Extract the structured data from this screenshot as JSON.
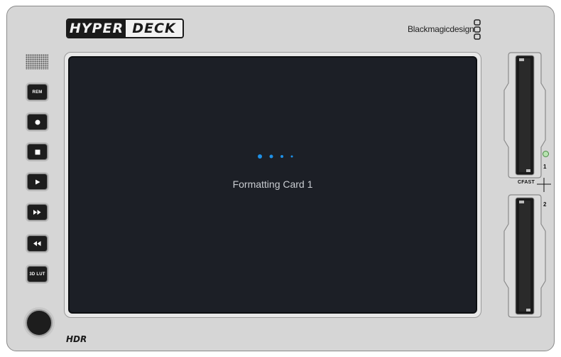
{
  "device": {
    "logo_left": "HYPER",
    "logo_right": "DECK",
    "brand": "Blackmagicdesign",
    "hdr_label": "HDR"
  },
  "buttons": [
    {
      "name": "rem-button",
      "label": "REM",
      "icon": "text"
    },
    {
      "name": "record-button",
      "label": "",
      "icon": "record-dot-icon"
    },
    {
      "name": "stop-button",
      "label": "",
      "icon": "stop-square-icon"
    },
    {
      "name": "play-button",
      "label": "",
      "icon": "play-triangle-icon"
    },
    {
      "name": "fast-forward-button",
      "label": "",
      "icon": "fast-forward-icon"
    },
    {
      "name": "rewind-button",
      "label": "",
      "icon": "rewind-icon"
    },
    {
      "name": "3d-lut-button",
      "label": "3D LUT",
      "icon": "text"
    }
  ],
  "screen": {
    "status_text": "Formatting Card 1",
    "progress_dots": 4
  },
  "slots": {
    "label": "CFAST",
    "slot1": "1",
    "slot2": "2",
    "led_color": "#4caf50"
  },
  "colors": {
    "accent": "#1e90e6",
    "screen_bg": "#1c1f26",
    "chassis": "#d6d6d6"
  }
}
